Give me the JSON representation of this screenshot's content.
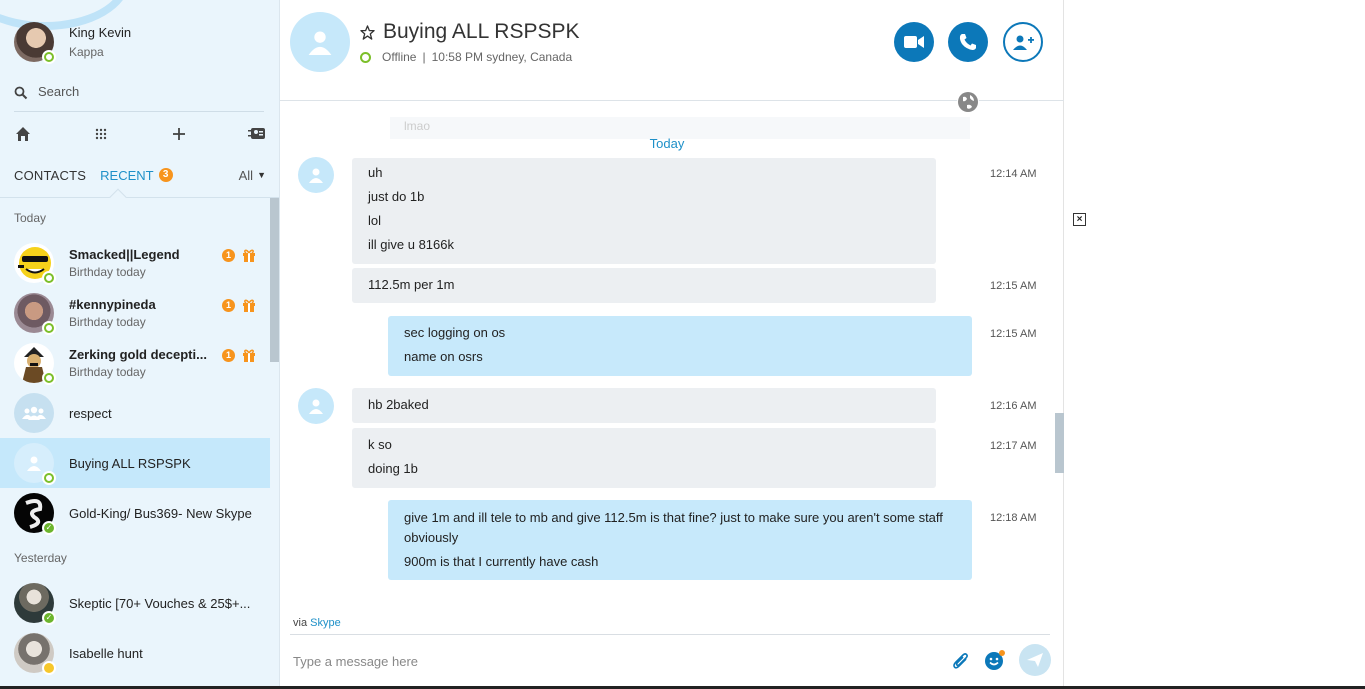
{
  "profile": {
    "name": "King Kevin",
    "mood": "Kappa"
  },
  "search": {
    "label": "Search"
  },
  "toolbar": {
    "icons": [
      "home-icon",
      "dialpad-icon",
      "plus-icon",
      "contacts-card-icon"
    ]
  },
  "tabs": {
    "contacts": "CONTACTS",
    "recent": "RECENT",
    "recent_badge": "3",
    "filter": "All"
  },
  "sections": {
    "today": "Today",
    "yesterday": "Yesterday"
  },
  "contacts": [
    {
      "name": "Smacked||Legend",
      "sub": "Birthday today",
      "badge": "1",
      "bold": true,
      "status": "online"
    },
    {
      "name": "#kennypineda",
      "sub": "Birthday today",
      "badge": "1",
      "bold": true,
      "status": "online"
    },
    {
      "name": "Zerking gold decepti...",
      "sub": "Birthday today",
      "badge": "1",
      "bold": true,
      "status": "online"
    },
    {
      "name": "respect",
      "sub": "",
      "status": "group"
    },
    {
      "name": "Buying ALL RSPSPK",
      "sub": "",
      "status": "online",
      "selected": true
    },
    {
      "name": "Gold-King/ Bus369- New Skype",
      "sub": "",
      "status": "available"
    },
    {
      "name": "Skeptic [70+ Vouches & 25$+...",
      "sub": "",
      "status": "available"
    },
    {
      "name": "Isabelle hunt",
      "sub": "",
      "status": "away"
    }
  ],
  "conversation": {
    "title": "Buying ALL RSPSPK",
    "status": "Offline",
    "separator": "|",
    "time_location": "10:58 PM sydney, Canada",
    "faded_message": "lmao",
    "day_label": "Today",
    "messages": [
      {
        "dir": "in",
        "lines": [
          "uh",
          "just do 1b",
          "lol",
          "ill give u 8166k"
        ],
        "time": "12:14 AM"
      },
      {
        "dir": "in",
        "lines": [
          "112.5m per 1m"
        ],
        "time": "12:15 AM"
      },
      {
        "dir": "out",
        "lines": [
          "sec logging on os",
          "name on osrs"
        ],
        "time": "12:15 AM"
      },
      {
        "dir": "in",
        "lines": [
          "hb 2baked"
        ],
        "time": "12:16 AM"
      },
      {
        "dir": "in",
        "lines": [
          "k so",
          "doing 1b"
        ],
        "time": "12:17 AM"
      },
      {
        "dir": "out",
        "lines": [
          "give 1m and ill tele to mb and give 112.5m is that fine? just to make sure you aren't some staff obviously",
          "900m is that I currently have cash"
        ],
        "time": "12:18 AM"
      }
    ],
    "via_prefix": "via",
    "via_link": "Skype",
    "compose_placeholder": "Type a message here"
  },
  "colors": {
    "accent": "#0c78b9",
    "selected_row": "#c5e8fb",
    "sidebar_bg": "#eaf5fc",
    "badge": "#f7941d",
    "outgoing_bubble": "#c7e9fb",
    "incoming_bubble": "#eceff2"
  }
}
